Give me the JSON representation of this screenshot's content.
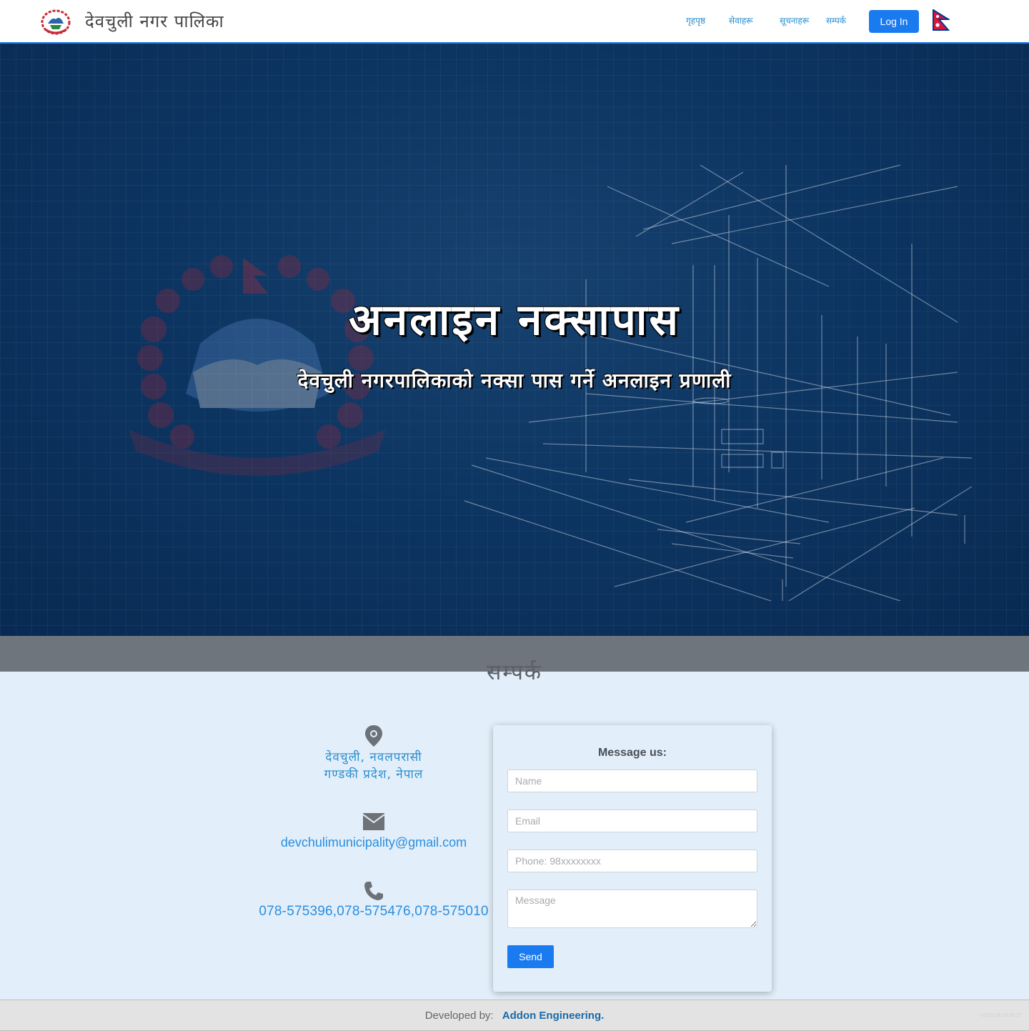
{
  "navbar": {
    "brand_title": "देवचुली नगर पालिका",
    "links": [
      "गृहपृष्ठ",
      "सेवाहरू",
      "सूचनाहरू",
      "सम्पर्क"
    ],
    "login_label": "Log In",
    "logo_icon": "nepal-emblem-icon",
    "flag_icon": "nepal-flag-icon"
  },
  "hero": {
    "title": "अनलाइन नक्सापास",
    "subtitle": "देवचुली नगरपालिकाको नक्सा पास गर्ने अनलाइन प्रणाली"
  },
  "contact": {
    "section_title": "सम्पर्क",
    "address_line1": "देवचुली, नवलपरासी",
    "address_line2": "गण्डकी प्रदेश, नेपाल",
    "email": "devchulimunicipality@gmail.com",
    "phone": "078-575396,078-575476,078-575010",
    "icons": [
      "map-pin-icon",
      "envelope-icon",
      "phone-icon"
    ]
  },
  "form": {
    "heading": "Message us:",
    "name_placeholder": "Name",
    "email_placeholder": "Email",
    "phone_placeholder": "Phone: 98xxxxxxxx",
    "message_placeholder": "Message",
    "send_label": "Send"
  },
  "footer": {
    "developed_by": "Developed by:",
    "developer": "Addon Engineering.",
    "stamp": "v2023.08.28.09.27"
  },
  "colors": {
    "accent": "#1a7bf0",
    "link": "#2a8fcf",
    "hero_bg": "#0d3562",
    "section_bg": "#e2eef9"
  }
}
